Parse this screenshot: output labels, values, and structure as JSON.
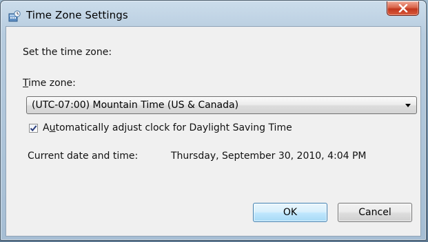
{
  "window": {
    "title": "Time Zone Settings",
    "icon": "clock-globe-icon",
    "close_icon": "close-icon"
  },
  "dialog": {
    "prompt": "Set the time zone:",
    "timezone_label_mnemonic": "T",
    "timezone_label_rest": "ime zone:",
    "timezone_selected": "(UTC-07:00) Mountain Time (US & Canada)",
    "dst_checkbox_checked": true,
    "dst_label_pre": "A",
    "dst_label_mnemonic": "u",
    "dst_label_rest": "tomatically adjust clock for Daylight Saving Time",
    "current_datetime_label": "Current date and time:",
    "current_datetime_value": "Thursday, September 30, 2010, 4:04 PM"
  },
  "buttons": {
    "ok": "OK",
    "cancel": "Cancel"
  },
  "colors": {
    "client_background": "#f0f0f0",
    "close_button": "#c1361d",
    "default_button_border": "#3c7fb1",
    "frame_glass": "#b8cde0"
  }
}
